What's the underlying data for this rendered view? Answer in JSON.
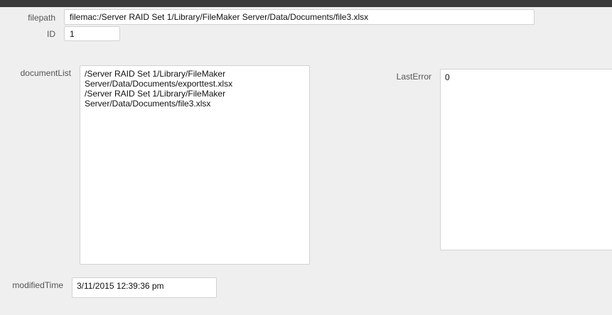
{
  "form": {
    "filepath": {
      "label": "filepath",
      "value": "filemac:/Server RAID Set 1/Library/FileMaker Server/Data/Documents/file3.xlsx"
    },
    "id": {
      "label": "ID",
      "value": "1"
    },
    "document_list": {
      "label": "documentList",
      "value": "/Server RAID Set 1/Library/FileMaker\nServer/Data/Documents/exporttest.xlsx\n/Server RAID Set 1/Library/FileMaker\nServer/Data/Documents/file3.xlsx"
    },
    "last_error": {
      "label": "LastError",
      "value": "0"
    },
    "modified_time": {
      "label": "modifiedTime",
      "value": "3/11/2015 12:39:36 pm"
    }
  }
}
